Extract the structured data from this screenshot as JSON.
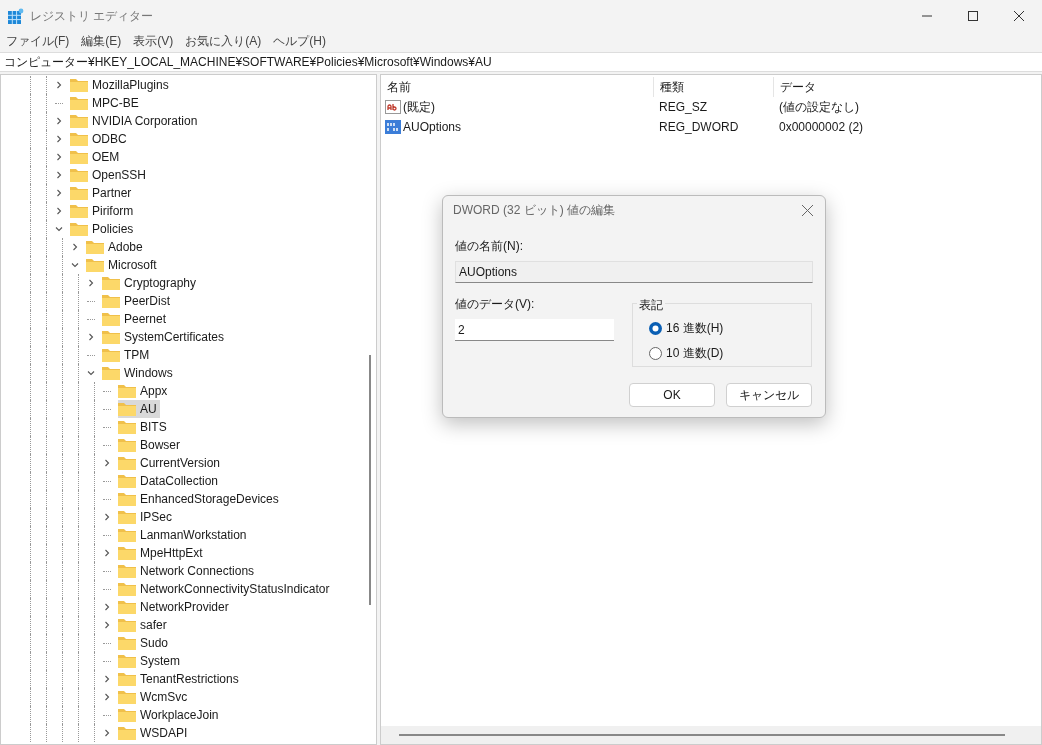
{
  "window": {
    "title": "レジストリ エディター"
  },
  "menu": [
    "ファイル(F)",
    "編集(E)",
    "表示(V)",
    "お気に入り(A)",
    "ヘルプ(H)"
  ],
  "address": "コンピューター¥HKEY_LOCAL_MACHINE¥SOFTWARE¥Policies¥Microsoft¥Windows¥AU",
  "tree": [
    {
      "label": "MozillaPlugins",
      "has_children": true,
      "expanded": false,
      "selected": false
    },
    {
      "label": "MPC-BE",
      "has_children": false,
      "selected": false
    },
    {
      "label": "NVIDIA Corporation",
      "has_children": true,
      "expanded": false,
      "selected": false
    },
    {
      "label": "ODBC",
      "has_children": true,
      "expanded": false,
      "selected": false
    },
    {
      "label": "OEM",
      "has_children": true,
      "expanded": false,
      "selected": false
    },
    {
      "label": "OpenSSH",
      "has_children": true,
      "expanded": false,
      "selected": false
    },
    {
      "label": "Partner",
      "has_children": true,
      "expanded": false,
      "selected": false
    },
    {
      "label": "Piriform",
      "has_children": true,
      "expanded": false,
      "selected": false
    },
    {
      "label": "Policies",
      "has_children": true,
      "expanded": true,
      "selected": false,
      "children": [
        {
          "label": "Adobe",
          "has_children": true,
          "expanded": false,
          "selected": false
        },
        {
          "label": "Microsoft",
          "has_children": true,
          "expanded": true,
          "selected": false,
          "children": [
            {
              "label": "Cryptography",
              "has_children": true,
              "expanded": false,
              "selected": false
            },
            {
              "label": "PeerDist",
              "has_children": false,
              "selected": false
            },
            {
              "label": "Peernet",
              "has_children": false,
              "selected": false
            },
            {
              "label": "SystemCertificates",
              "has_children": true,
              "expanded": false,
              "selected": false
            },
            {
              "label": "TPM",
              "has_children": false,
              "selected": false
            },
            {
              "label": "Windows",
              "has_children": true,
              "expanded": true,
              "selected": false,
              "children": [
                {
                  "label": "Appx",
                  "has_children": false,
                  "selected": false
                },
                {
                  "label": "AU",
                  "has_children": false,
                  "selected": true
                },
                {
                  "label": "BITS",
                  "has_children": false,
                  "selected": false
                },
                {
                  "label": "Bowser",
                  "has_children": false,
                  "selected": false
                },
                {
                  "label": "CurrentVersion",
                  "has_children": true,
                  "expanded": false,
                  "selected": false
                },
                {
                  "label": "DataCollection",
                  "has_children": false,
                  "selected": false
                },
                {
                  "label": "EnhancedStorageDevices",
                  "has_children": false,
                  "selected": false
                },
                {
                  "label": "IPSec",
                  "has_children": true,
                  "expanded": false,
                  "selected": false
                },
                {
                  "label": "LanmanWorkstation",
                  "has_children": false,
                  "selected": false
                },
                {
                  "label": "MpeHttpExt",
                  "has_children": true,
                  "expanded": false,
                  "selected": false
                },
                {
                  "label": "Network Connections",
                  "has_children": false,
                  "selected": false
                },
                {
                  "label": "NetworkConnectivityStatusIndicator",
                  "has_children": false,
                  "selected": false
                },
                {
                  "label": "NetworkProvider",
                  "has_children": true,
                  "expanded": false,
                  "selected": false
                },
                {
                  "label": "safer",
                  "has_children": true,
                  "expanded": false,
                  "selected": false
                },
                {
                  "label": "Sudo",
                  "has_children": false,
                  "selected": false
                },
                {
                  "label": "System",
                  "has_children": false,
                  "selected": false
                },
                {
                  "label": "TenantRestrictions",
                  "has_children": true,
                  "expanded": false,
                  "selected": false
                },
                {
                  "label": "WcmSvc",
                  "has_children": true,
                  "expanded": false,
                  "selected": false
                },
                {
                  "label": "WorkplaceJoin",
                  "has_children": false,
                  "selected": false
                },
                {
                  "label": "WSDAPI",
                  "has_children": true,
                  "expanded": false,
                  "selected": false
                }
              ]
            }
          ]
        }
      ]
    }
  ],
  "table": {
    "columns": [
      "名前",
      "種類",
      "データ"
    ],
    "rows": [
      {
        "kind": "string",
        "name": "(既定)",
        "type": "REG_SZ",
        "data": "(値の設定なし)"
      },
      {
        "kind": "binary",
        "name": "AUOptions",
        "type": "REG_DWORD",
        "data": "0x00000002 (2)"
      }
    ]
  },
  "dialog": {
    "title": "DWORD (32 ビット) 値の編集",
    "name_label": "値の名前(N):",
    "name_value": "AUOptions",
    "data_label": "値のデータ(V):",
    "data_value": "2",
    "base_label": "表記",
    "bases": [
      {
        "label": "16 進数(H)",
        "selected": true
      },
      {
        "label": "10 進数(D)",
        "selected": false
      }
    ],
    "buttons": [
      "OK",
      "キャンセル"
    ]
  }
}
